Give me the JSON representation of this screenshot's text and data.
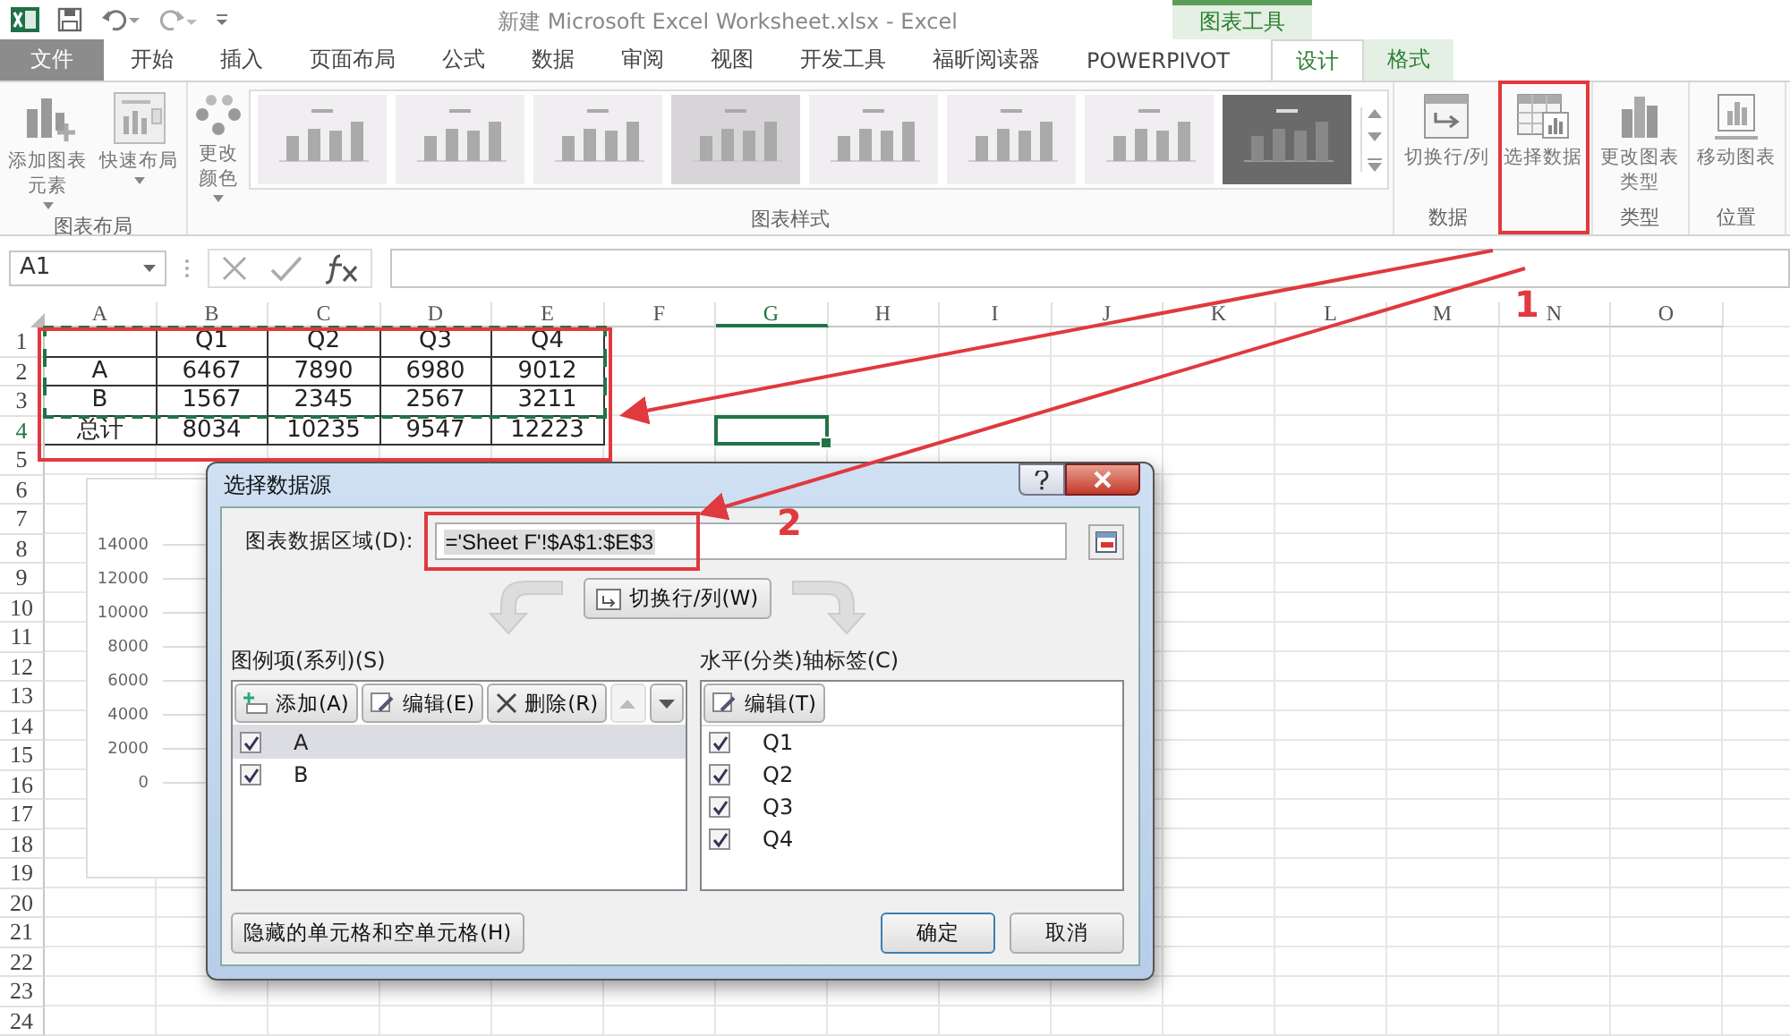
{
  "window": {
    "title": "新建 Microsoft Excel Worksheet.xlsx - Excel"
  },
  "context_tab_group": {
    "label": "图表工具"
  },
  "tabs": [
    {
      "label": "文件",
      "kind": "file",
      "selected": false
    },
    {
      "label": "开始",
      "kind": "normal",
      "selected": false
    },
    {
      "label": "插入",
      "kind": "normal",
      "selected": false
    },
    {
      "label": "页面布局",
      "kind": "normal",
      "selected": false
    },
    {
      "label": "公式",
      "kind": "normal",
      "selected": false
    },
    {
      "label": "数据",
      "kind": "normal",
      "selected": false
    },
    {
      "label": "审阅",
      "kind": "normal",
      "selected": false
    },
    {
      "label": "视图",
      "kind": "normal",
      "selected": false
    },
    {
      "label": "开发工具",
      "kind": "normal",
      "selected": false
    },
    {
      "label": "福昕阅读器",
      "kind": "normal",
      "selected": false
    },
    {
      "label": "POWERPIVOT",
      "kind": "normal",
      "selected": false
    },
    {
      "label": "设计",
      "kind": "context",
      "selected": true
    },
    {
      "label": "格式",
      "kind": "context",
      "selected": false
    }
  ],
  "ribbon": {
    "groups": [
      {
        "label": "图表布局",
        "buttons": [
          {
            "label": "添加图表元素",
            "dropdown": true
          },
          {
            "label": "快速布局",
            "dropdown": true
          }
        ]
      },
      {
        "label": "图表样式",
        "buttons": [
          {
            "label": "更改颜色",
            "dropdown": true
          }
        ],
        "styles": [
          {
            "kind": "light",
            "selected": false
          },
          {
            "kind": "light",
            "selected": false
          },
          {
            "kind": "light",
            "selected": false
          },
          {
            "kind": "light",
            "selected": true
          },
          {
            "kind": "light",
            "selected": false
          },
          {
            "kind": "light",
            "selected": false
          },
          {
            "kind": "light",
            "selected": false
          },
          {
            "kind": "dark",
            "selected": false
          }
        ]
      },
      {
        "label": "数据",
        "buttons": [
          {
            "label": "切换行/列",
            "dropdown": false
          },
          {
            "label": "选择数据",
            "dropdown": false
          }
        ]
      },
      {
        "label": "类型",
        "buttons": [
          {
            "label": "更改图表类型",
            "dropdown": false
          }
        ]
      },
      {
        "label": "位置",
        "buttons": [
          {
            "label": "移动图表",
            "dropdown": false
          }
        ]
      }
    ]
  },
  "formula_bar": {
    "name_box": "A1"
  },
  "sheet": {
    "columns": [
      {
        "label": "A",
        "selected": false
      },
      {
        "label": "B",
        "selected": false
      },
      {
        "label": "C",
        "selected": false
      },
      {
        "label": "D",
        "selected": false
      },
      {
        "label": "E",
        "selected": false
      },
      {
        "label": "F",
        "selected": false
      },
      {
        "label": "G",
        "selected": true
      },
      {
        "label": "H",
        "selected": false
      },
      {
        "label": "I",
        "selected": false
      },
      {
        "label": "J",
        "selected": false
      },
      {
        "label": "K",
        "selected": false
      },
      {
        "label": "L",
        "selected": false
      },
      {
        "label": "M",
        "selected": false
      },
      {
        "label": "N",
        "selected": false
      },
      {
        "label": "O",
        "selected": false
      }
    ],
    "rows": [
      {
        "label": "1",
        "selected": false
      },
      {
        "label": "2",
        "selected": false
      },
      {
        "label": "3",
        "selected": false
      },
      {
        "label": "4",
        "selected": true
      },
      {
        "label": "5",
        "selected": false
      },
      {
        "label": "6",
        "selected": false
      },
      {
        "label": "7",
        "selected": false
      },
      {
        "label": "8",
        "selected": false
      },
      {
        "label": "9",
        "selected": false
      },
      {
        "label": "10",
        "selected": false
      },
      {
        "label": "11",
        "selected": false
      },
      {
        "label": "12",
        "selected": false
      },
      {
        "label": "13",
        "selected": false
      },
      {
        "label": "14",
        "selected": false
      },
      {
        "label": "15",
        "selected": false
      },
      {
        "label": "16",
        "selected": false
      },
      {
        "label": "17",
        "selected": false
      },
      {
        "label": "18",
        "selected": false
      },
      {
        "label": "19",
        "selected": false
      },
      {
        "label": "20",
        "selected": false
      },
      {
        "label": "21",
        "selected": false
      },
      {
        "label": "22",
        "selected": false
      },
      {
        "label": "23",
        "selected": false
      },
      {
        "label": "24",
        "selected": false
      }
    ],
    "table_rows": [
      {
        "values": [
          "Q1",
          "Q2",
          "Q3",
          "Q4"
        ],
        "copied": true
      },
      {
        "label": "A",
        "values": [
          "6467",
          "7890",
          "6980",
          "9012"
        ],
        "copied": true
      },
      {
        "label": "B",
        "values": [
          "1567",
          "2345",
          "2567",
          "3211"
        ],
        "copied": true
      },
      {
        "label": "总计",
        "values": [
          "8034",
          "10235",
          "9547",
          "12223"
        ],
        "copied": false
      }
    ]
  },
  "chart": {
    "y_ticks": [
      "14000",
      "12000",
      "10000",
      "8000",
      "6000",
      "4000",
      "2000",
      "0"
    ]
  },
  "dialog": {
    "title": "选择数据源",
    "range_label": "图表数据区域(D):",
    "range_value": "='Sheet F'!$A$1:$E$3",
    "switch_button": "切换行/列(W)",
    "series_label": "图例项(系列)(S)",
    "series_buttons": [
      "添加(A)",
      "编辑(E)",
      "删除(R)"
    ],
    "move_buttons": [
      {
        "kind": "up",
        "disabled": true
      },
      {
        "kind": "down",
        "disabled": false
      }
    ],
    "series": [
      {
        "label": "A",
        "checked": true,
        "selected": true
      },
      {
        "label": "B",
        "checked": true,
        "selected": false
      }
    ],
    "axis_label": "水平(分类)轴标签(C)",
    "axis_button": "编辑(T)",
    "categories": [
      {
        "label": "Q1",
        "checked": true
      },
      {
        "label": "Q2",
        "checked": true
      },
      {
        "label": "Q3",
        "checked": true
      },
      {
        "label": "Q4",
        "checked": true
      }
    ],
    "hidden_cells_button": "隐藏的单元格和空单元格(H)",
    "ok_button": "确定",
    "cancel_button": "取消"
  },
  "annotations": [
    {
      "label": "1"
    },
    {
      "label": "2"
    }
  ]
}
